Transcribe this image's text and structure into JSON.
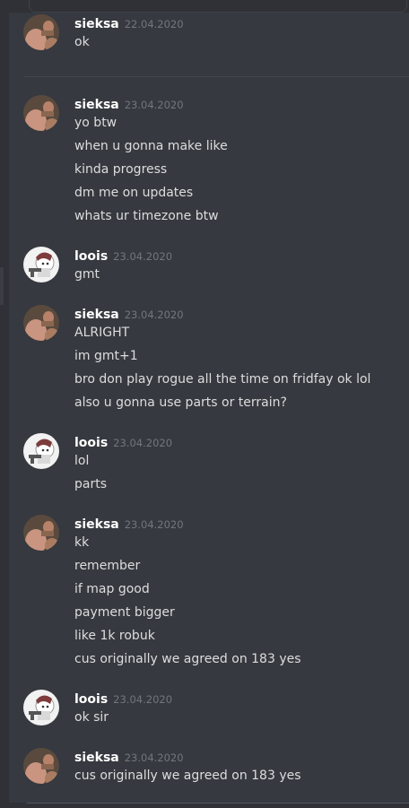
{
  "messages": [
    {
      "author": "sieksa",
      "date": "22.04.2020",
      "lines": [
        "ok"
      ]
    },
    {
      "author": "sieksa",
      "date": "23.04.2020",
      "lines": [
        "yo btw",
        "when u gonna make like",
        "kinda progress",
        "dm me on updates",
        "whats ur timezone btw"
      ]
    },
    {
      "author": "loois",
      "date": "23.04.2020",
      "lines": [
        "gmt"
      ]
    },
    {
      "author": "sieksa",
      "date": "23.04.2020",
      "lines": [
        "ALRIGHT",
        "im gmt+1",
        "bro don play rogue all the time on fridfay ok lol",
        "also u gonna use parts or terrain?"
      ]
    },
    {
      "author": "loois",
      "date": "23.04.2020",
      "lines": [
        "lol",
        "parts"
      ]
    },
    {
      "author": "sieksa",
      "date": "23.04.2020",
      "lines": [
        "kk",
        "remember",
        "if map good",
        "payment bigger",
        "like 1k robuk",
        "cus originally we agreed on 183 yes"
      ]
    },
    {
      "author": "loois",
      "date": "23.04.2020",
      "lines": [
        "ok sir"
      ]
    },
    {
      "author": "sieksa",
      "date": "23.04.2020",
      "lines": [
        "cus originally we agreed on 183 yes"
      ]
    }
  ],
  "colors": {
    "background": "#36393f",
    "username": "#ffffff",
    "timestamp": "#72767d",
    "message_text": "#dcddde"
  }
}
